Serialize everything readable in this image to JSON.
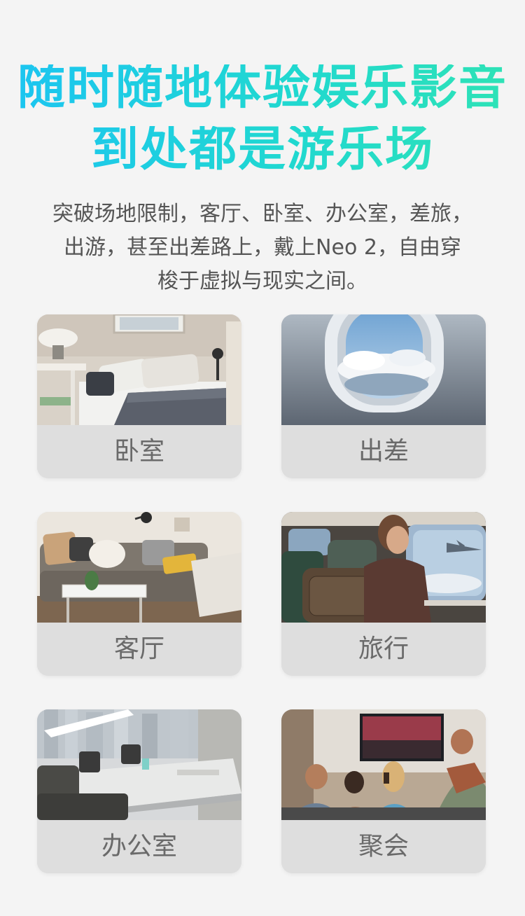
{
  "hero": {
    "title_line1": "随时随地体验娱乐影音",
    "title_line2": "到处都是游乐场",
    "subtitle_line1": "突破场地限制，客厅、卧室、办公室，差旅，",
    "subtitle_line2": "出游，甚至出差路上，戴上Neo 2，自由穿",
    "subtitle_line3": "梭于虚拟与现实之间。"
  },
  "scenes": [
    {
      "label": "卧室"
    },
    {
      "label": "出差"
    },
    {
      "label": "客厅"
    },
    {
      "label": "旅行"
    },
    {
      "label": "办公室"
    },
    {
      "label": "聚会"
    }
  ],
  "colors": {
    "title_gradient_start": "#1cc4f2",
    "title_gradient_end": "#2fe3b4",
    "background": "#f4f4f4",
    "card_label_bg": "#dedede",
    "label_text": "#6a6a6a"
  }
}
